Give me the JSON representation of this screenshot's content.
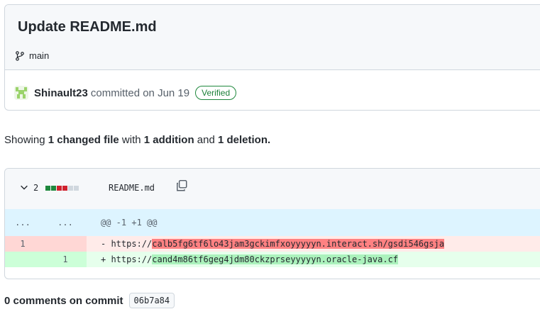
{
  "commit": {
    "title": "Update README.md",
    "branch": "main",
    "author": "Shinault23",
    "action": "committed on Jun 19",
    "verified": "Verified"
  },
  "summary": {
    "prefix": "Showing",
    "changed": "1 changed file",
    "with": "with",
    "additions": "1 addition",
    "and": "and",
    "deletions": "1 deletion."
  },
  "file": {
    "change_count": "2",
    "name": "README.md",
    "diffstat": [
      "add",
      "add",
      "del",
      "del",
      "neutral",
      "neutral"
    ],
    "colors": {
      "add": "#1f883d",
      "del": "#cf222e",
      "neutral": "#d0d7de"
    },
    "hunk": {
      "old_ln": "...",
      "new_ln": "...",
      "header": "@@ -1 +1 @@"
    },
    "deleted_line": {
      "old_ln": "1",
      "prefix": "- https://",
      "highlight": "calb5fg6tf6lo43jam3gckimfxoyyyyyn.interact.sh/gsdi546gsja"
    },
    "added_line": {
      "new_ln": "1",
      "prefix": "+ https://",
      "highlight": "cand4m86tf6geg4jdm80ckzprseyyyyyn.oracle-java.cf"
    }
  },
  "comments": {
    "label": "0 comments on commit",
    "sha": "06b7a84"
  }
}
